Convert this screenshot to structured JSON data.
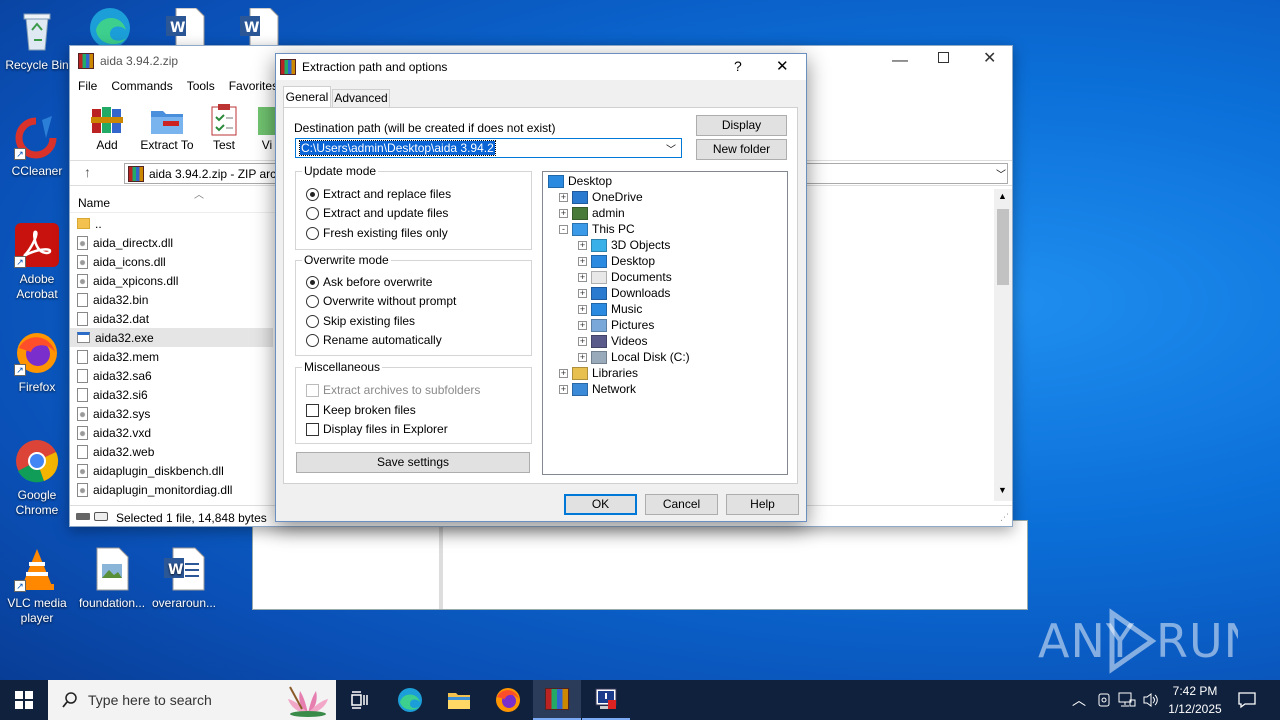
{
  "desktop": {
    "icons": [
      {
        "label": "Recycle Bin",
        "icon": "recycle-bin-icon"
      },
      {
        "label": "CCleaner",
        "icon": "ccleaner-icon"
      },
      {
        "label": "Adobe Acrobat",
        "icon": "acrobat-icon"
      },
      {
        "label": "Firefox",
        "icon": "firefox-icon"
      },
      {
        "label": "Google Chrome",
        "icon": "chrome-icon"
      },
      {
        "label": "VLC media player",
        "icon": "vlc-icon"
      },
      {
        "label": "foundation...",
        "icon": "image-file-icon"
      },
      {
        "label": "overaroun...",
        "icon": "word-doc-icon"
      }
    ],
    "watermark": "ANY RUN"
  },
  "winrar": {
    "title": "aida 3.94.2.zip",
    "menu": [
      "File",
      "Commands",
      "Tools",
      "Favorites"
    ],
    "toolbar": [
      "Add",
      "Extract To",
      "Test",
      "Vi"
    ],
    "address": "aida 3.94.2.zip - ZIP arch",
    "column_name": "Name",
    "files": [
      "..",
      "aida_directx.dll",
      "aida_icons.dll",
      "aida_xpicons.dll",
      "aida32.bin",
      "aida32.dat",
      "aida32.exe",
      "aida32.mem",
      "aida32.sa6",
      "aida32.si6",
      "aida32.sys",
      "aida32.vxd",
      "aida32.web",
      "aidaplugin_diskbench.dll",
      "aidaplugin_monitordiag.dll"
    ],
    "selected_index": 6,
    "status": "Selected 1 file, 14,848 bytes"
  },
  "dialog": {
    "title": "Extraction path and options",
    "help_glyph": "?",
    "close_glyph": "✕",
    "tabs": [
      "General",
      "Advanced"
    ],
    "active_tab": "General",
    "dest_label": "Destination path (will be created if does not exist)",
    "dest_value": "C:\\Users\\admin\\Desktop\\aida 3.94.2",
    "display_button": "Display",
    "new_folder_button": "New folder",
    "update_mode": {
      "label": "Update mode",
      "options": [
        "Extract and replace files",
        "Extract and update files",
        "Fresh existing files only"
      ],
      "selected": 0
    },
    "overwrite_mode": {
      "label": "Overwrite mode",
      "options": [
        "Ask before overwrite",
        "Overwrite without prompt",
        "Skip existing files",
        "Rename automatically"
      ],
      "selected": 0
    },
    "misc": {
      "label": "Miscellaneous",
      "options": [
        {
          "label": "Extract archives to subfolders",
          "checked": false,
          "disabled": true
        },
        {
          "label": "Keep broken files",
          "checked": false,
          "disabled": false
        },
        {
          "label": "Display files in Explorer",
          "checked": false,
          "disabled": false
        }
      ]
    },
    "save_settings": "Save settings",
    "tree": [
      {
        "label": "Desktop",
        "icon": "desktop-icon"
      },
      {
        "label": "OneDrive",
        "icon": "onedrive-icon"
      },
      {
        "label": "admin",
        "icon": "user-icon"
      },
      {
        "label": "This PC",
        "icon": "computer-icon"
      },
      {
        "label": "3D Objects",
        "icon": "3d-objects-icon"
      },
      {
        "label": "Desktop",
        "icon": "desktop-icon"
      },
      {
        "label": "Documents",
        "icon": "documents-icon"
      },
      {
        "label": "Downloads",
        "icon": "downloads-icon"
      },
      {
        "label": "Music",
        "icon": "music-icon"
      },
      {
        "label": "Pictures",
        "icon": "pictures-icon"
      },
      {
        "label": "Videos",
        "icon": "videos-icon"
      },
      {
        "label": "Local Disk (C:)",
        "icon": "disk-icon"
      },
      {
        "label": "Libraries",
        "icon": "libraries-icon"
      },
      {
        "label": "Network",
        "icon": "network-icon"
      }
    ],
    "ok": "OK",
    "cancel": "Cancel",
    "help": "Help"
  },
  "taskbar": {
    "search_placeholder": "Type here to search",
    "time": "7:42 PM",
    "date": "1/12/2025"
  },
  "colors": {
    "accent": "#0078d7",
    "selection": "#0a64d6",
    "taskbar": "#10213d"
  }
}
